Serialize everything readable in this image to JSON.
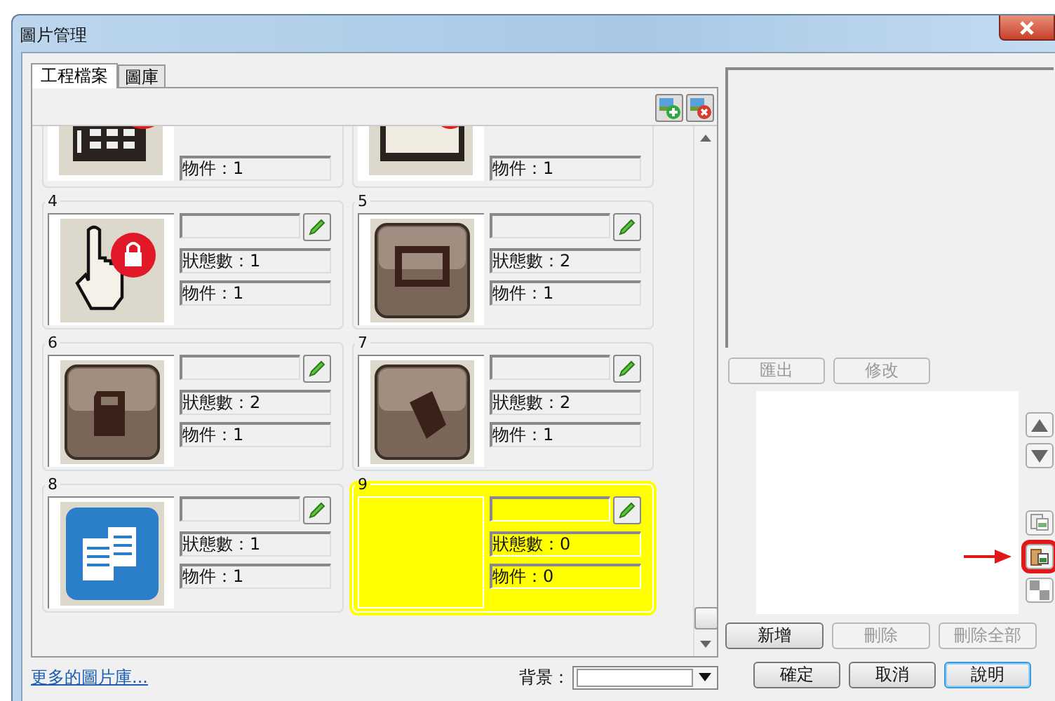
{
  "window": {
    "title": "圖片管理"
  },
  "tabs": [
    {
      "label": "工程檔案",
      "selected": true
    },
    {
      "label": "圖庫",
      "selected": false
    }
  ],
  "pictures": [
    {
      "kind": "partial",
      "objects": "物件：1",
      "selected": false
    },
    {
      "kind": "partial",
      "objects": "物件：1",
      "selected": false
    },
    {
      "kind": "full",
      "number": "4",
      "states": "狀態數：1",
      "objects": "物件：1",
      "selected": false
    },
    {
      "kind": "full",
      "number": "5",
      "states": "狀態數：2",
      "objects": "物件：1",
      "selected": false
    },
    {
      "kind": "full",
      "number": "6",
      "states": "狀態數：2",
      "objects": "物件：1",
      "selected": false
    },
    {
      "kind": "full",
      "number": "7",
      "states": "狀態數：2",
      "objects": "物件：1",
      "selected": false
    },
    {
      "kind": "full",
      "number": "8",
      "states": "狀態數：1",
      "objects": "物件：1",
      "selected": false
    },
    {
      "kind": "full",
      "number": "9",
      "states": "狀態數：0",
      "objects": "物件：0",
      "selected": true
    }
  ],
  "more_link": "更多的圖片庫...",
  "background": {
    "label": "背景："
  },
  "preview_buttons": [
    {
      "label": "匯出",
      "disabled": true
    },
    {
      "label": "修改",
      "disabled": true
    }
  ],
  "side_tools": [
    {
      "kind": "up",
      "highlighted": false
    },
    {
      "kind": "down",
      "highlighted": false
    },
    {
      "kind": "copy",
      "highlighted": false
    },
    {
      "kind": "paste",
      "highlighted": true
    },
    {
      "kind": "checker",
      "highlighted": false
    }
  ],
  "list_buttons": [
    {
      "label": "新增",
      "disabled": false
    },
    {
      "label": "刪除",
      "disabled": true
    },
    {
      "label": "刪除全部",
      "disabled": true
    }
  ],
  "dialog_buttons": [
    {
      "label": "確定",
      "focused": false
    },
    {
      "label": "取消",
      "focused": false
    },
    {
      "label": "說明",
      "focused": true
    }
  ]
}
